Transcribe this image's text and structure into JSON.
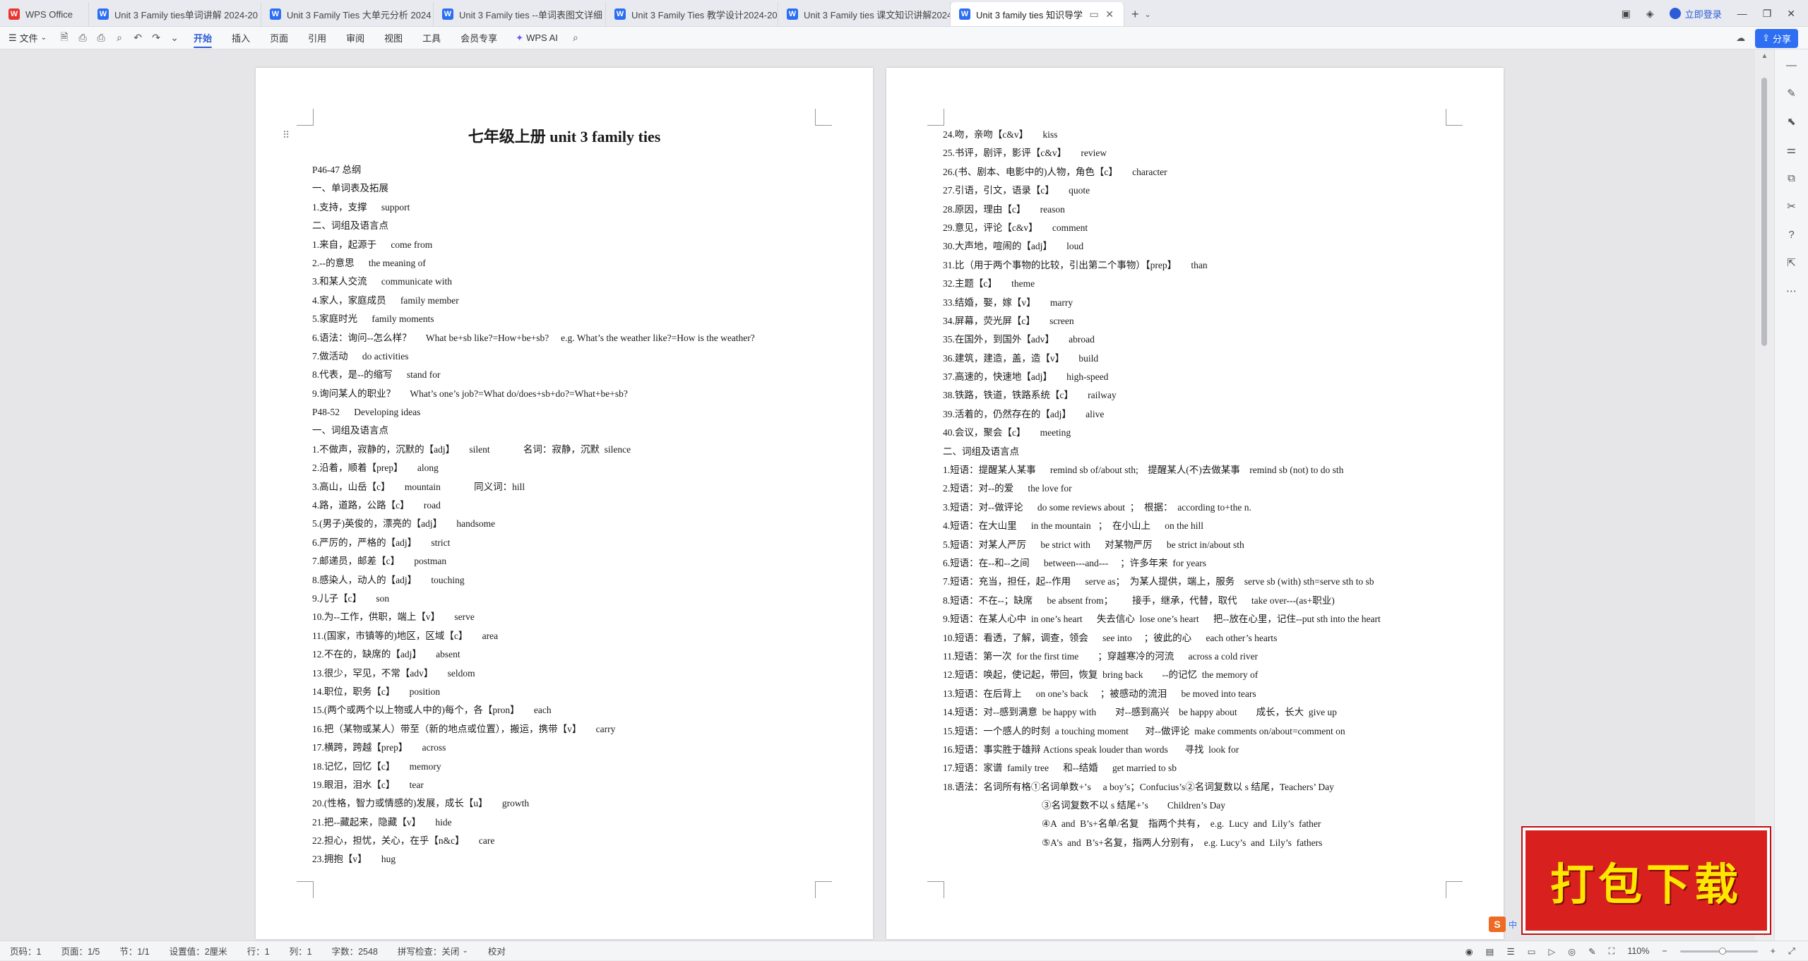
{
  "tabs": [
    {
      "label": "WPS Office",
      "type": "app"
    },
    {
      "label": "Unit 3  Family ties单词讲解 2024-20",
      "type": "doc"
    },
    {
      "label": "Unit 3 Family Ties 大单元分析 2024",
      "type": "doc"
    },
    {
      "label": "Unit 3 Family ties --单词表图文详细",
      "type": "doc"
    },
    {
      "label": "Unit 3 Family Ties 教学设计2024-20",
      "type": "doc"
    },
    {
      "label": "Unit 3 Family ties 课文知识讲解2024",
      "type": "doc"
    },
    {
      "label": "Unit 3 family ties 知识导学",
      "type": "doc",
      "active": true
    }
  ],
  "header_right": {
    "login": "立即登录"
  },
  "toolbar": {
    "file": "文件",
    "menus": [
      "开始",
      "插入",
      "页面",
      "引用",
      "审阅",
      "视图",
      "工具",
      "会员专享"
    ],
    "active_menu": "开始",
    "wps_ai": "WPS AI",
    "share": "分享"
  },
  "page1": {
    "title": "七年级上册 unit 3 family ties",
    "lines": [
      "P46-47 总纲",
      "一、单词表及拓展",
      "1.支持，支撑      support",
      "二、词组及语言点",
      "1.来自，起源于      come from",
      "2.--的意思      the meaning of",
      "3.和某人交流      communicate with",
      "4.家人，家庭成员      family member",
      "5.家庭时光      family moments",
      "6.语法：询问--怎么样？      What be+sb like?=How+be+sb?     e.g. What’s the weather like?=How is the weather?",
      "7.做活动      do activities",
      "8.代表，是--的缩写      stand for",
      "9.询问某人的职业？      What’s one’s job?=What do/does+sb+do?=What+be+sb?",
      "P48-52      Developing ideas",
      "一、词组及语言点",
      "1.不做声，寂静的，沉默的【adj】      silent              名词：寂静，沉默  silence",
      "2.沿着，顺着【prep】      along",
      "3.高山，山岳【c】      mountain              同义词：hill",
      "4.路，道路，公路【c】      road",
      "5.(男子)英俊的，漂亮的【adj】      handsome",
      "6.严厉的，严格的【adj】      strict",
      "7.邮递员，邮差【c】      postman",
      "8.感染人，动人的【adj】      touching",
      "9.儿子【c】      son",
      "10.为--工作，供职，端上【v】      serve",
      "11.(国家，市镇等的)地区，区域【c】      area",
      "12.不在的，缺席的【adj】      absent",
      "13.很少，罕见，不常【adv】      seldom",
      "14.职位，职务【c】      position",
      "15.(两个或两个以上物或人中的)每个，各【pron】      each",
      "16.把（某物或某人）带至（新的地点或位置），搬运，携带【v】      carry",
      "17.横跨，跨越【prep】      across",
      "18.记忆，回忆【c】      memory",
      "19.眼泪，泪水【c】      tear",
      "20.(性格，智力或情感的)发展，成长【u】      growth",
      "21.把--藏起来，隐藏【v】      hide",
      "22.担心，担忧，关心，在乎【n&c】      care",
      "23.拥抱【v】      hug"
    ]
  },
  "page2": {
    "lines": [
      "24.吻，亲吻【c&v】      kiss",
      "25.书评，剧评，影评【c&v】      review",
      "26.(书、剧本、电影中的)人物，角色【c】      character",
      "27.引语，引文，语录【c】      quote",
      "28.原因，理由【c】      reason",
      "29.意见，评论【c&v】      comment",
      "30.大声地，喧闹的【adj】      loud",
      "31.比（用于两个事物的比较，引出第二个事物）【prep】      than",
      "32.主题【c】      theme",
      "33.结婚，娶，嫁【v】      marry",
      "34.屏幕，荧光屏【c】      screen",
      "35.在国外，到国外【adv】      abroad",
      "36.建筑，建造，盖，造【v】      build",
      "37.高速的，快速地【adj】      high-speed",
      "38.铁路，铁道，铁路系统【c】      railway",
      "39.活着的，仍然存在的【adj】      alive",
      "40.会议，聚会【c】      meeting",
      "二、词组及语言点",
      "1.短语：提醒某人某事      remind sb of/about sth;    提醒某人(不)去做某事    remind sb (not) to do sth",
      "2.短语：对--的爱      the love for",
      "3.短语：对--做评论      do some reviews about  ；  根据：  according to+the n.",
      "4.短语：在大山里      in the mountain   ；  在小山上      on the hill",
      "5.短语：对某人严厉      be strict with      对某物严厉      be strict in/about sth",
      "6.短语：在--和--之间      between---and---     ；许多年来  for years",
      "7.短语：充当，担任，起--作用      serve as；  为某人提供，端上，服务    serve sb (with) sth=serve sth to sb",
      "8.短语：不在--；缺席      be absent from；        接手，继承，代替，取代      take over---(as+职业)",
      "9.短语：在某人心中  in one’s heart      失去信心  lose one’s heart      把--放在心里，记住--put sth into the heart",
      "10.短语：看透，了解，调查，领会      see into     ；彼此的心      each other’s hearts",
      "11.短语：第一次  for the first time        ；穿越寒冷的河流      across a cold river",
      "12.短语：唤起，使记起，带回，恢复  bring back        --的记忆  the memory of",
      "13.短语：在后背上      on one’s back     ；被感动的流泪      be moved into tears",
      "14.短语：对--感到满意  be happy with        对--感到高兴    be happy about        成长，长大  give up",
      "15.短语：一个感人的时刻  a touching moment       对--做评论  make comments on/about=comment on",
      "16.短语：事实胜于雄辩 Actions speak louder than words       寻找  look for",
      "17.短语：家谱  family tree      和--结婚      get married to sb",
      "18.语法：名词所有格①名词单数+’s     a boy’s；Confucius’s②名词复数以 s 结尾，Teachers’ Day",
      "③名词复数不以 s 结尾+’s        Children’s Day",
      "④A  and  B’s+名单/名复    指两个共有，  e.g.  Lucy  and  Lily’s  father",
      "⑤A’s  and  B’s+名复，指两人分别有，  e.g. Lucy’s  and  Lily’s  fathers"
    ],
    "indent_from": 36
  },
  "statusbar": {
    "page_num": "页码：1",
    "pages": "页面：1/5",
    "section": "节：1/1",
    "setting": "设置值：2厘米",
    "row": "行：1",
    "col": "列：1",
    "word_count": "字数：2548",
    "spell_check": "拼写检查：关闭",
    "proofread": "校对",
    "zoom": "110%"
  },
  "promo": {
    "text": "打包下载"
  },
  "ime": {
    "label": "S",
    "text": "中"
  }
}
